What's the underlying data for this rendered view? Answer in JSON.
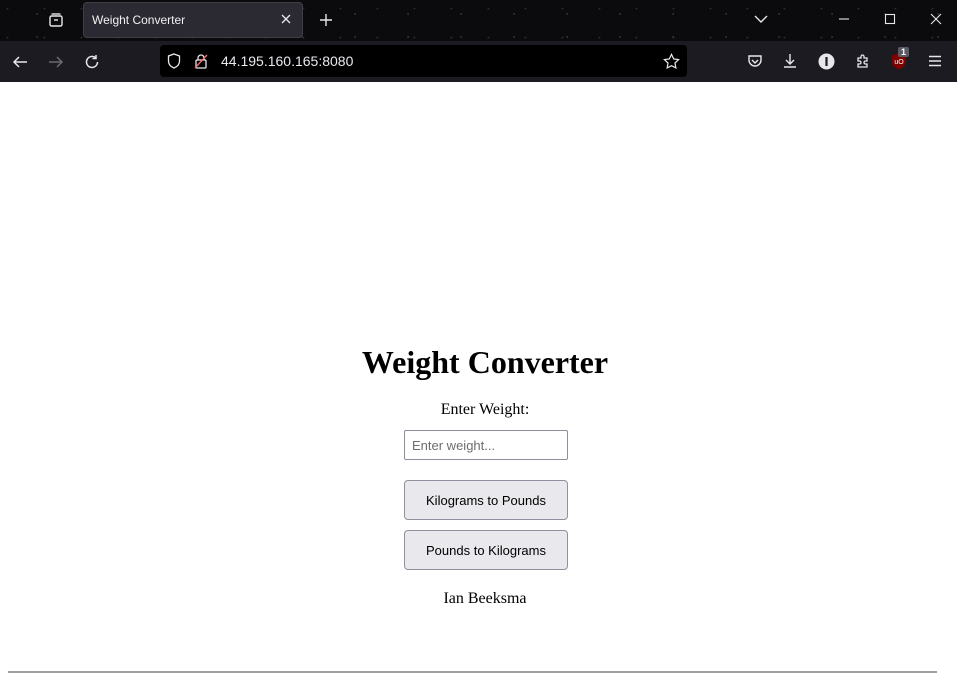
{
  "browser": {
    "tab": {
      "title": "Weight Converter"
    },
    "url": "44.195.160.165:8080",
    "extension_badge": "1"
  },
  "page": {
    "heading": "Weight Converter",
    "input_label": "Enter Weight:",
    "input_placeholder": "Enter weight...",
    "input_value": "",
    "buttons": {
      "kg_to_lb": "Kilograms to Pounds",
      "lb_to_kg": "Pounds to Kilograms"
    },
    "author": "Ian Beeksma"
  },
  "colors": {
    "tab_bg": "#2b2a33",
    "nav_bg": "#1c1b22",
    "button_bg": "#e9e9ed"
  }
}
